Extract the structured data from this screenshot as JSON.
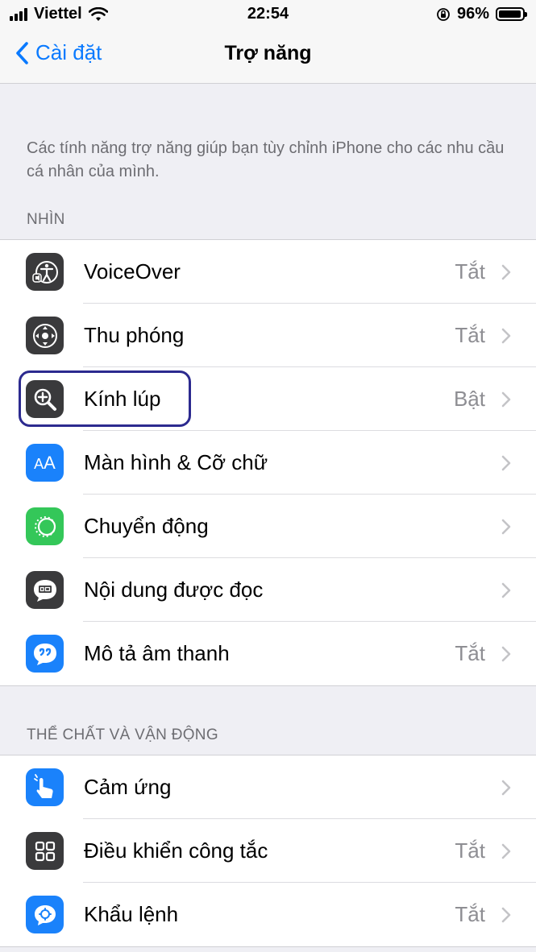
{
  "status_bar": {
    "carrier": "Viettel",
    "time": "22:54",
    "battery": "96%",
    "battery_level": 0.96
  },
  "nav": {
    "back_label": "Cài đặt",
    "title": "Trợ năng"
  },
  "intro_text": "Các tính năng trợ năng giúp bạn tùy chỉnh iPhone cho các nhu cầu cá nhân của mình.",
  "sections": [
    {
      "header": "NHÌN",
      "items": [
        {
          "label": "VoiceOver",
          "value": "Tắt",
          "icon": "voiceover-icon",
          "icon_color": "#3a3a3c"
        },
        {
          "label": "Thu phóng",
          "value": "Tắt",
          "icon": "zoom-icon",
          "icon_color": "#3a3a3c"
        },
        {
          "label": "Kính lúp",
          "value": "Bật",
          "icon": "magnifier-icon",
          "icon_color": "#3a3a3c"
        },
        {
          "label": "Màn hình & Cỡ chữ",
          "value": "",
          "icon": "text-size-icon",
          "icon_color": "#1a82fb"
        },
        {
          "label": "Chuyển động",
          "value": "",
          "icon": "motion-icon",
          "icon_color": "#34c759"
        },
        {
          "label": "Nội dung được đọc",
          "value": "",
          "icon": "spoken-content-icon",
          "icon_color": "#3a3a3c"
        },
        {
          "label": "Mô tả âm thanh",
          "value": "Tắt",
          "icon": "audio-description-icon",
          "icon_color": "#1a82fb"
        }
      ]
    },
    {
      "header": "THỂ CHẤT VÀ VẬN ĐỘNG",
      "items": [
        {
          "label": "Cảm ứng",
          "value": "",
          "icon": "touch-icon",
          "icon_color": "#1a82fb"
        },
        {
          "label": "Điều khiển công tắc",
          "value": "Tắt",
          "icon": "switch-control-icon",
          "icon_color": "#3a3a3c"
        },
        {
          "label": "Khẩu lệnh",
          "value": "Tắt",
          "icon": "voice-control-icon",
          "icon_color": "#1a82fb"
        }
      ]
    }
  ],
  "colors": {
    "accent": "#0a7aff",
    "highlight": "#2c2a8f"
  }
}
